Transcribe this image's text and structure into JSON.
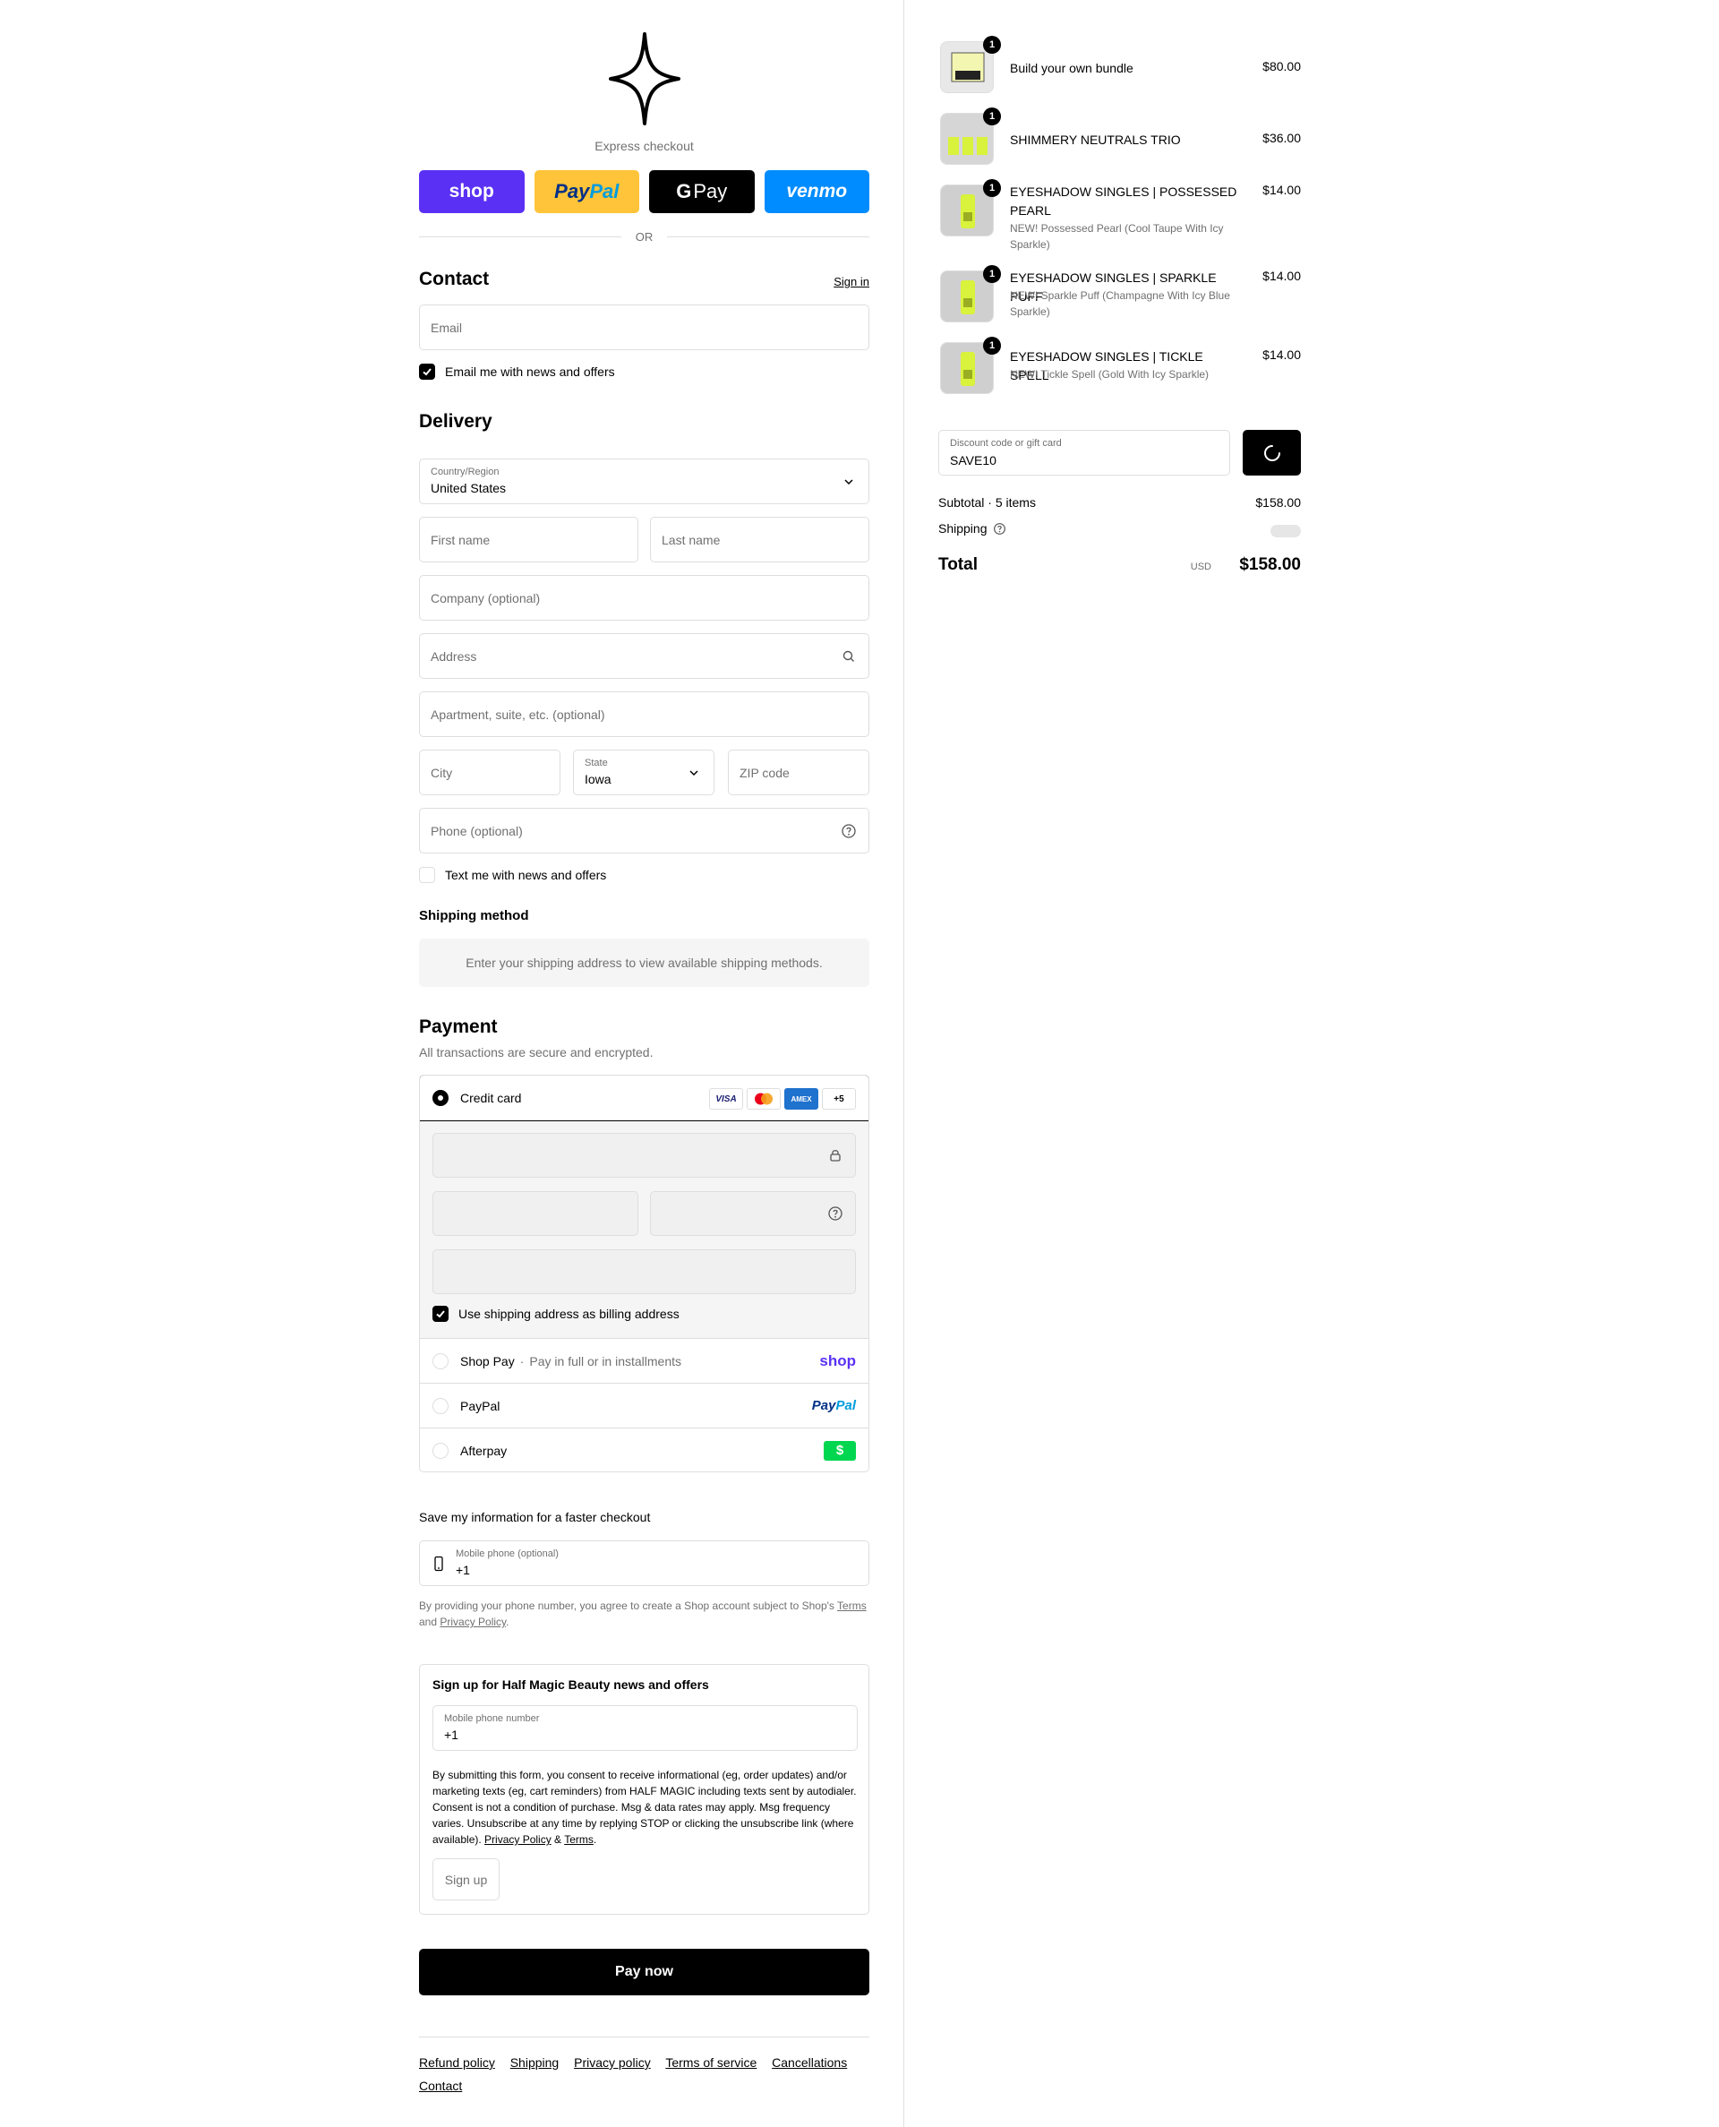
{
  "express": {
    "label": "Express checkout",
    "shop": "shop",
    "paypal_a": "Pay",
    "paypal_b": "Pal",
    "gpay_g": "G",
    "gpay": "Pay",
    "venmo": "venmo",
    "or": "OR"
  },
  "contact": {
    "title": "Contact",
    "sign_in": "Sign in",
    "email_placeholder": "Email",
    "news_label": "Email me with news and offers"
  },
  "delivery": {
    "title": "Delivery",
    "country_label": "Country/Region",
    "country_value": "United States",
    "first_name": "First name",
    "last_name": "Last name",
    "company": "Company (optional)",
    "address": "Address",
    "apartment": "Apartment, suite, etc. (optional)",
    "city": "City",
    "state_label": "State",
    "state_value": "Iowa",
    "zip": "ZIP code",
    "phone": "Phone (optional)",
    "text_label": "Text me with news and offers"
  },
  "shipping_method": {
    "title": "Shipping method",
    "message": "Enter your shipping address to view available shipping methods."
  },
  "payment": {
    "title": "Payment",
    "subtitle": "All transactions are secure and encrypted.",
    "credit_card": "Credit card",
    "card_visa": "VISA",
    "card_amex": "AMEX",
    "card_more": "+5",
    "billing_label": "Use shipping address as billing address",
    "shop_pay": "Shop Pay",
    "shop_pay_sep": "·",
    "shop_pay_sub": "Pay in full or in installments",
    "shop_logo": "shop",
    "paypal": "PayPal",
    "paypal_logo_a": "Pay",
    "paypal_logo_b": "Pal",
    "afterpay": "Afterpay",
    "afterpay_logo": "$"
  },
  "save_info": {
    "title": "Save my information for a faster checkout",
    "mobile_label": "Mobile phone (optional)",
    "mobile_value": "+1",
    "note_a": "By providing your phone number, you agree to create a Shop account subject to Shop's ",
    "terms": "Terms",
    "note_b": "and ",
    "privacy": "Privacy Policy",
    "note_c": "."
  },
  "signup": {
    "title": "Sign up for Half Magic Beauty news and offers",
    "mobile_label": "Mobile phone number",
    "mobile_value": "+1",
    "consent": "By submitting this form, you consent to receive informational (eg, order updates) and/or marketing texts (eg, cart reminders) from HALF MAGIC including texts sent by autodialer. Consent is not a condition of purchase. Msg & data rates may apply. Msg frequency varies. Unsubscribe at any time by replying STOP or clicking the unsubscribe link (where available). ",
    "privacy": "Privacy Policy",
    "amp": " & ",
    "terms": "Terms",
    "period": ".",
    "button": "Sign up"
  },
  "pay_now": "Pay now",
  "footer": {
    "refund": "Refund policy",
    "shipping": "Shipping",
    "privacy": "Privacy policy",
    "terms": "Terms of service",
    "cancellations": "Cancellations",
    "contact": "Contact"
  },
  "order": {
    "items": [
      {
        "qty": "1",
        "name": "Build your own bundle",
        "variant": "",
        "price": "$80.00"
      },
      {
        "qty": "1",
        "name": "SHIMMERY NEUTRALS TRIO",
        "variant": "",
        "price": "$36.00"
      },
      {
        "qty": "1",
        "name": "EYESHADOW SINGLES | POSSESSED PEARL",
        "variant": "NEW! Possessed Pearl (Cool Taupe With Icy Sparkle)",
        "price": "$14.00"
      },
      {
        "qty": "1",
        "name": "EYESHADOW SINGLES | SPARKLE PUFF",
        "variant": "NEW! Sparkle Puff (Champagne With Icy Blue Sparkle)",
        "price": "$14.00"
      },
      {
        "qty": "1",
        "name": "EYESHADOW SINGLES | TICKLE SPELL",
        "variant": "NEW! Tickle Spell (Gold With Icy Sparkle)",
        "price": "$14.00"
      }
    ],
    "discount_label": "Discount code or gift card",
    "discount_value": "SAVE10",
    "subtotal_label": "Subtotal · 5 items",
    "subtotal_value": "$158.00",
    "shipping_label": "Shipping",
    "total_label": "Total",
    "currency": "USD",
    "total_value": "$158.00"
  }
}
